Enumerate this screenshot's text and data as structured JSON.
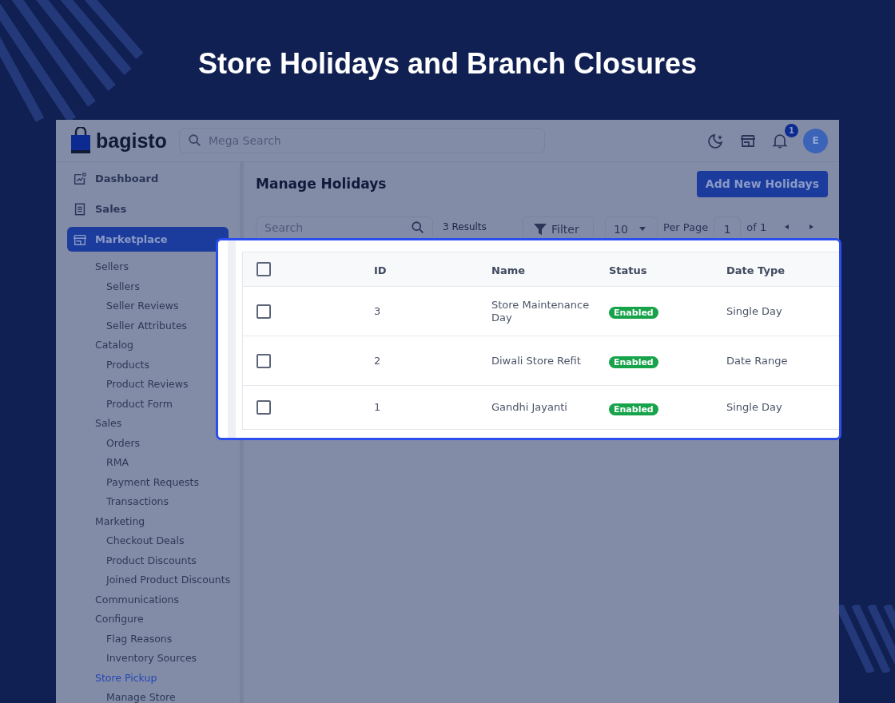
{
  "headline": "Store Holidays and Branch Closures",
  "app": {
    "logo": "bagisto",
    "search": {
      "placeholder": "Mega Search"
    },
    "notifications": "1",
    "avatar": "E"
  },
  "sidebar": {
    "items": [
      {
        "label": "Dashboard",
        "selected": false
      },
      {
        "label": "Sales",
        "selected": false
      },
      {
        "label": "Marketplace",
        "selected": true,
        "children": [
          {
            "label": "Sellers",
            "selected": false,
            "children": [
              {
                "label": "Sellers",
                "selected": false
              },
              {
                "label": "Seller Reviews",
                "selected": false
              },
              {
                "label": "Seller Attributes",
                "selected": false
              }
            ]
          },
          {
            "label": "Catalog",
            "selected": false,
            "children": [
              {
                "label": "Products",
                "selected": false
              },
              {
                "label": "Product Reviews",
                "selected": false
              },
              {
                "label": "Product Form",
                "selected": false
              }
            ]
          },
          {
            "label": "Sales",
            "selected": false,
            "children": [
              {
                "label": "Orders",
                "selected": false
              },
              {
                "label": "RMA",
                "selected": false
              },
              {
                "label": "Payment Requests",
                "selected": false
              },
              {
                "label": "Transactions",
                "selected": false
              }
            ]
          },
          {
            "label": "Marketing",
            "selected": false,
            "children": [
              {
                "label": "Checkout Deals",
                "selected": false
              },
              {
                "label": "Product Discounts",
                "selected": false
              },
              {
                "label": "Joined Product Discounts",
                "selected": false
              }
            ]
          },
          {
            "label": "Communications",
            "selected": false
          },
          {
            "label": "Configure",
            "selected": false,
            "children": [
              {
                "label": "Flag Reasons",
                "selected": false
              },
              {
                "label": "Inventory Sources",
                "selected": false
              }
            ]
          },
          {
            "label": "Store Pickup",
            "selected": true,
            "children": [
              {
                "label": "Manage Store",
                "selected": false
              }
            ]
          }
        ]
      }
    ]
  },
  "page": {
    "title": "Manage Holidays",
    "add_button": "Add New Holidays"
  },
  "toolbar": {
    "search": {
      "placeholder": "Search"
    },
    "results": "3 Results",
    "filter": "Filter",
    "per_page": "10",
    "per_page_label": "Per Page",
    "page": "1",
    "page_total": "of 1"
  },
  "table": {
    "select_all": {
      "checked": false
    },
    "columns": [
      "ID",
      "Name",
      "Status",
      "Date Type"
    ],
    "rows": [
      {
        "checked": false,
        "id": "3",
        "name": "Store Maintenance Day",
        "status": {
          "kind": "enabled",
          "label": "Enabled"
        },
        "date_type": "Single Day"
      },
      {
        "checked": false,
        "id": "2",
        "name": "Diwali Store Refit",
        "status": {
          "kind": "enabled",
          "label": "Enabled"
        },
        "date_type": "Date Range"
      },
      {
        "checked": false,
        "id": "1",
        "name": "Gandhi Jayanti",
        "status": {
          "kind": "enabled",
          "label": "Enabled"
        },
        "date_type": "Single Day"
      }
    ]
  }
}
